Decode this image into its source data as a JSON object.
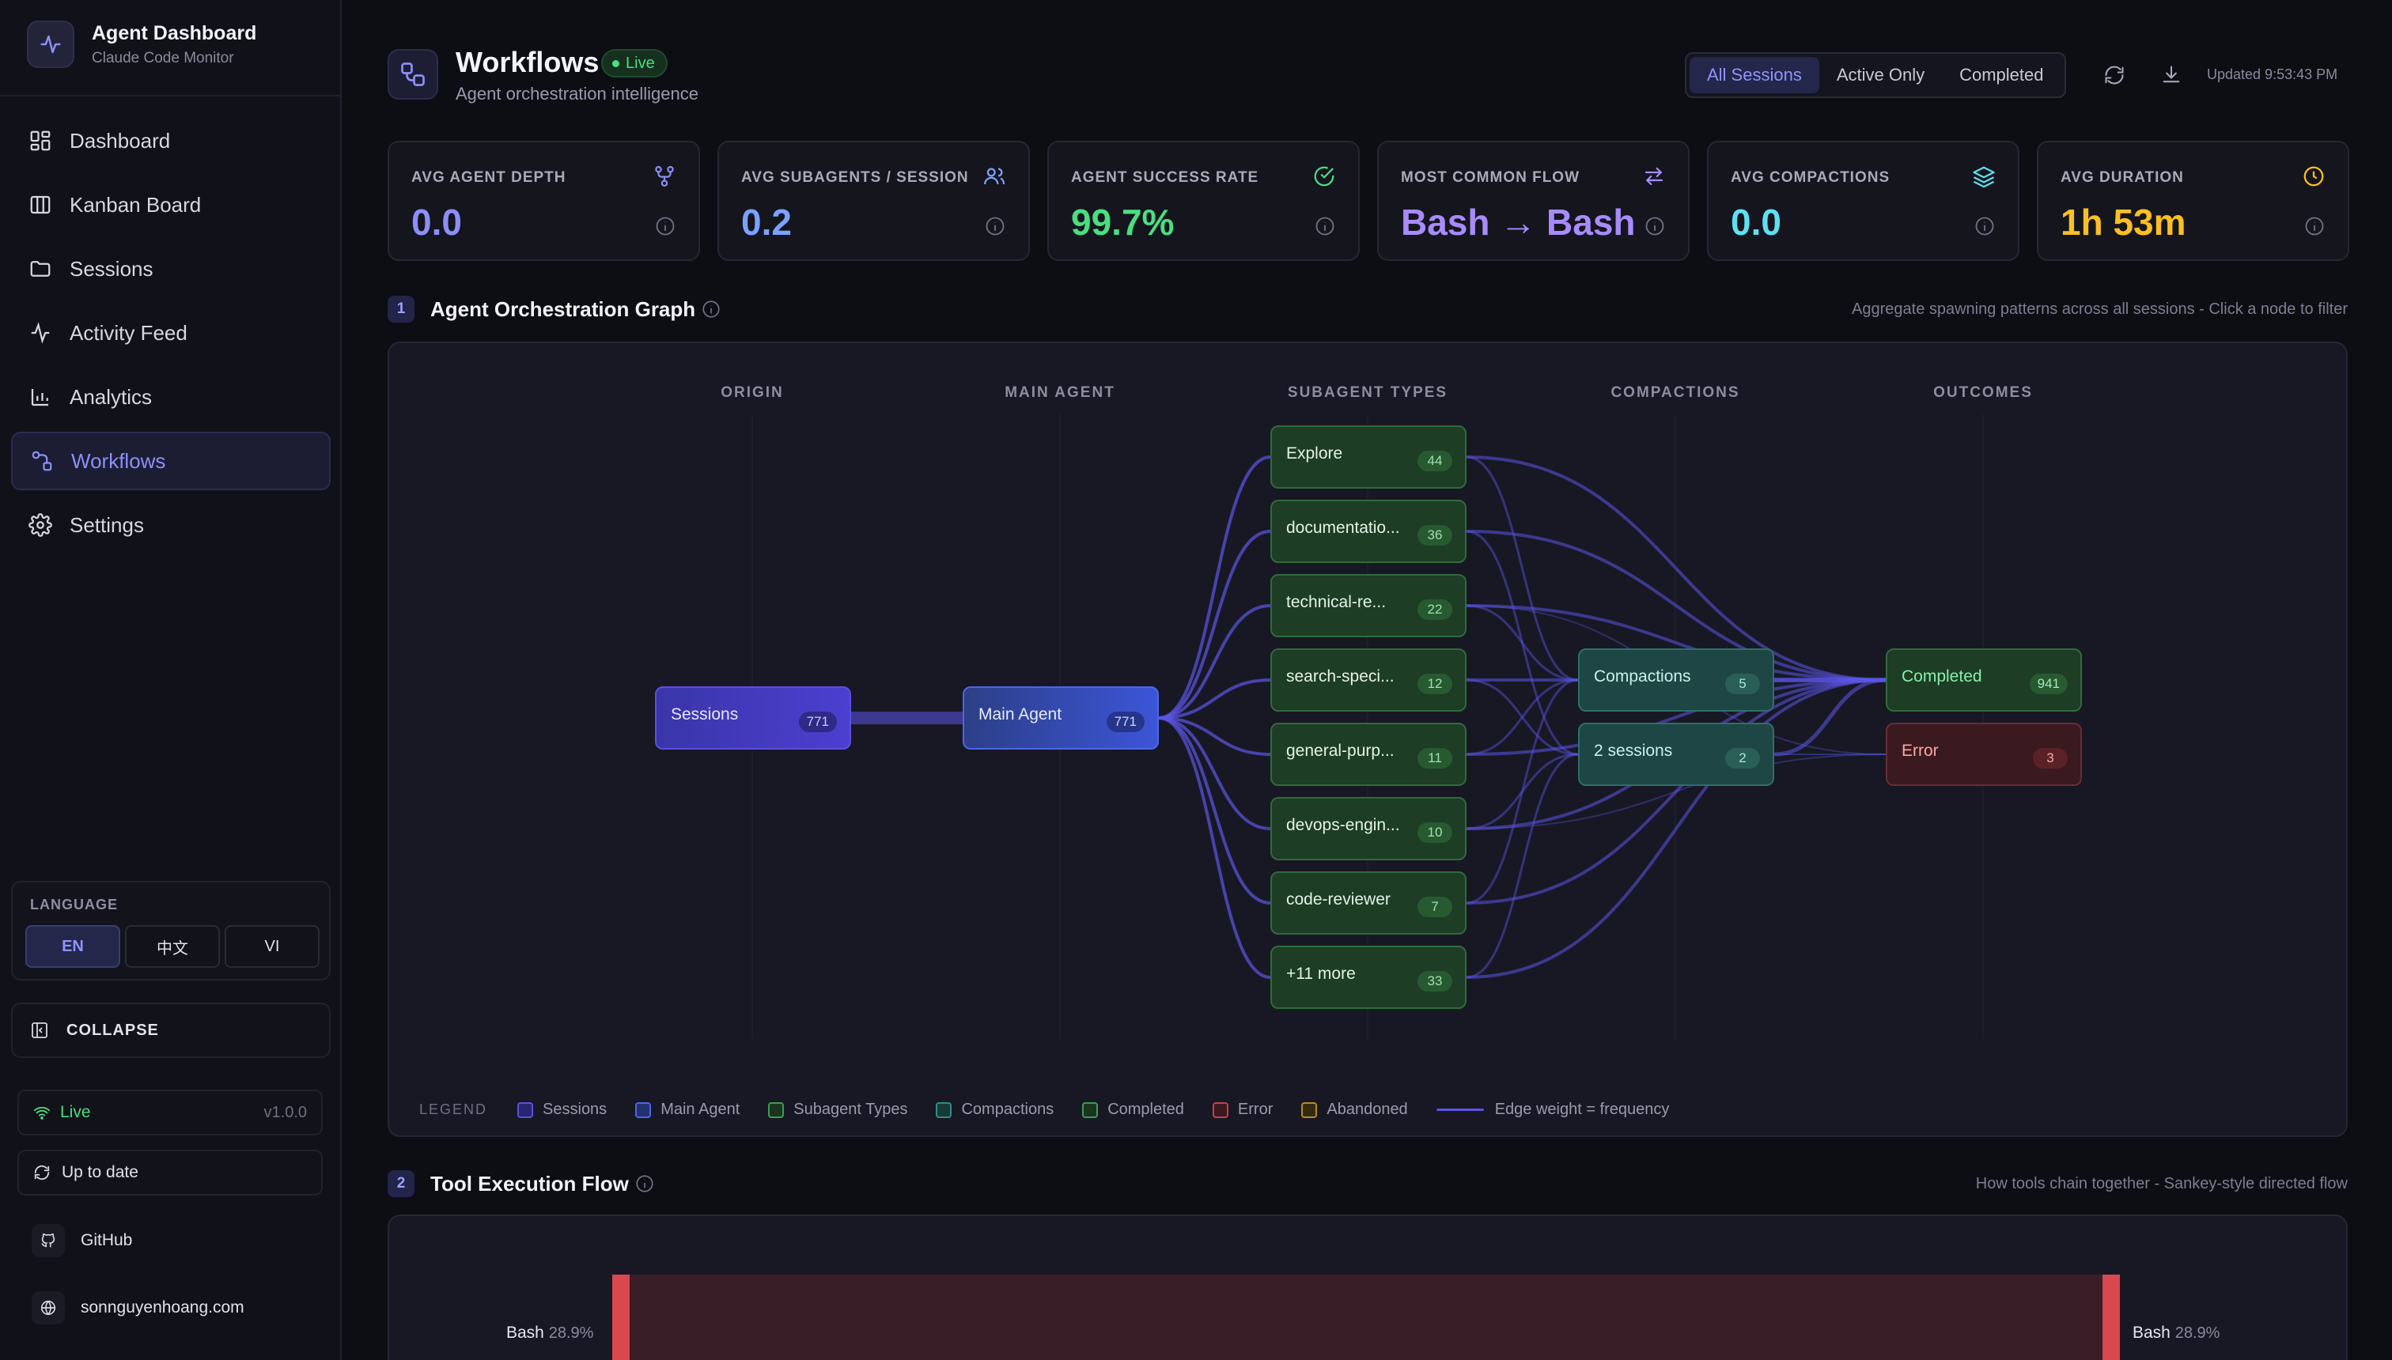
{
  "brand": {
    "title": "Agent Dashboard",
    "subtitle": "Claude Code Monitor"
  },
  "nav": [
    {
      "label": "Dashboard",
      "icon": "grid-icon"
    },
    {
      "label": "Kanban Board",
      "icon": "columns-icon"
    },
    {
      "label": "Sessions",
      "icon": "folder-icon"
    },
    {
      "label": "Activity Feed",
      "icon": "pulse-icon"
    },
    {
      "label": "Analytics",
      "icon": "bar-chart-icon"
    },
    {
      "label": "Workflows",
      "icon": "workflow-icon",
      "active": true
    },
    {
      "label": "Settings",
      "icon": "gear-icon"
    }
  ],
  "language": {
    "label": "LANGUAGE",
    "options": [
      "EN",
      "中文",
      "VI"
    ],
    "selected": "EN"
  },
  "collapse_label": "COLLAPSE",
  "status": {
    "live": "Live",
    "version": "v1.0.0",
    "update": "Up to date"
  },
  "links": {
    "github": "GitHub",
    "site": "sonnguyenhoang.com"
  },
  "header": {
    "title": "Workflows",
    "badge": "Live",
    "subtitle": "Agent orchestration intelligence",
    "filters": [
      "All Sessions",
      "Active Only",
      "Completed"
    ],
    "selected_filter": "All Sessions",
    "updated": "Updated 9:53:43 PM"
  },
  "stats": [
    {
      "label": "AVG AGENT DEPTH",
      "value": "0.0",
      "color": "#8b8ff7",
      "icon": "branch-icon"
    },
    {
      "label": "AVG SUBAGENTS / SESSION",
      "value": "0.2",
      "color": "#7aa2ff",
      "icon": "users-icon"
    },
    {
      "label": "AGENT SUCCESS RATE",
      "value": "99.7%",
      "color": "#4ade80",
      "icon": "check-circle-icon"
    },
    {
      "label": "MOST COMMON FLOW",
      "value": "Bash → Bash",
      "color": "#a78bfa",
      "icon": "swap-icon"
    },
    {
      "label": "AVG COMPACTIONS",
      "value": "0.0",
      "color": "#5ee0f0",
      "icon": "layers-icon"
    },
    {
      "label": "AVG DURATION",
      "value": "1h 53m",
      "color": "#fbbf24",
      "icon": "clock-icon"
    }
  ],
  "orchestration": {
    "number": "1",
    "title": "Agent Orchestration Graph",
    "hint": "Aggregate spawning patterns across all sessions - Click a node to filter",
    "columns": [
      "ORIGIN",
      "MAIN AGENT",
      "SUBAGENT TYPES",
      "COMPACTIONS",
      "OUTCOMES"
    ],
    "sessions": {
      "label": "Sessions",
      "count": "771"
    },
    "main_agent": {
      "label": "Main Agent",
      "count": "771"
    },
    "subagents": [
      {
        "label": "Explore",
        "count": "44"
      },
      {
        "label": "documentatio...",
        "count": "36"
      },
      {
        "label": "technical-re...",
        "count": "22"
      },
      {
        "label": "search-speci...",
        "count": "12"
      },
      {
        "label": "general-purp...",
        "count": "11"
      },
      {
        "label": "devops-engin...",
        "count": "10"
      },
      {
        "label": "code-reviewer",
        "count": "7"
      },
      {
        "label": "+11 more",
        "count": "33"
      }
    ],
    "compactions": [
      {
        "label": "Compactions",
        "count": "5"
      },
      {
        "label": "2 sessions",
        "count": "2"
      }
    ],
    "outcomes": [
      {
        "label": "Completed",
        "count": "941"
      },
      {
        "label": "Error",
        "count": "3"
      }
    ],
    "legend": {
      "title": "LEGEND",
      "items": [
        {
          "label": "Sessions",
          "color": "#5a4fe0"
        },
        {
          "label": "Main Agent",
          "color": "#4b66e8"
        },
        {
          "label": "Subagent Types",
          "color": "#3f9b50"
        },
        {
          "label": "Compactions",
          "color": "#2e8f85"
        },
        {
          "label": "Completed",
          "color": "#3f9b50"
        },
        {
          "label": "Error",
          "color": "#c0434c"
        },
        {
          "label": "Abandoned",
          "color": "#b58a2a"
        }
      ],
      "edge_note": "Edge weight = frequency"
    }
  },
  "tool_flow": {
    "number": "2",
    "title": "Tool Execution Flow",
    "hint": "How tools chain together - Sankey-style directed flow",
    "left": {
      "label": "Bash",
      "pct": "28.9%"
    },
    "right": {
      "label": "Bash",
      "pct": "28.9%"
    }
  }
}
